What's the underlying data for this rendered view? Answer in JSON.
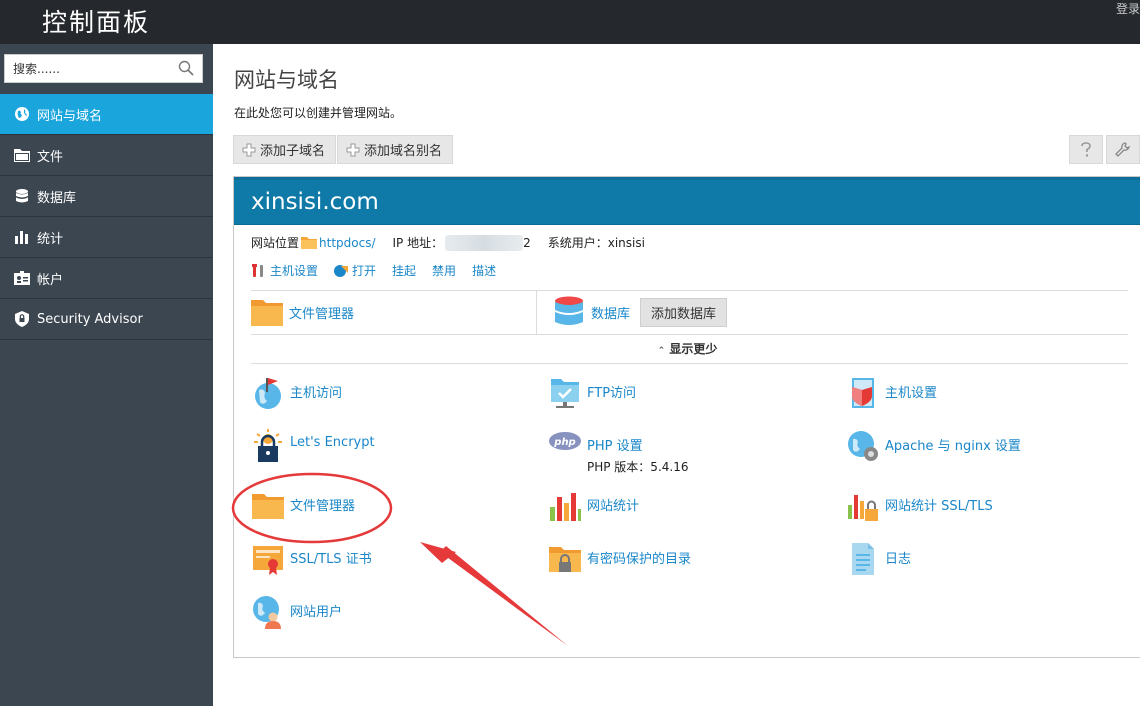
{
  "header": {
    "title": "控制面板",
    "login": "登录"
  },
  "sidebar": {
    "search_placeholder": "搜索......",
    "items": [
      {
        "label": "网站与域名",
        "icon": "globe-icon",
        "active": true
      },
      {
        "label": "文件",
        "icon": "folder-icon"
      },
      {
        "label": "数据库",
        "icon": "database-icon"
      },
      {
        "label": "统计",
        "icon": "bar-chart-icon"
      },
      {
        "label": "帐户",
        "icon": "id-card-icon"
      },
      {
        "label": "Security Advisor",
        "icon": "shield-icon"
      }
    ]
  },
  "main": {
    "title": "网站与域名",
    "description": "在此处您可以创建并管理网站。",
    "toolbar": {
      "add_subdomain": "添加子域名",
      "add_alias": "添加域名别名"
    },
    "domain": {
      "name": "xinsisi.com",
      "location_label": "网站位置",
      "location_link": "httpdocs/",
      "ip_label": "IP 地址：",
      "ip_tail": "2",
      "user_label": "系统用户：",
      "user_value": "xinsisi",
      "actions": [
        "主机设置",
        "打开",
        "挂起",
        "禁用",
        "描述"
      ],
      "quick": {
        "file_manager": "文件管理器",
        "database": "数据库",
        "add_database": "添加数据库"
      },
      "show_less": "显示更少",
      "tools": {
        "hosting_access": "主机访问",
        "ftp_access": "FTP访问",
        "hosting_settings": "主机设置",
        "lets_encrypt": "Let's Encrypt",
        "php_settings": "PHP 设置",
        "php_version": "PHP 版本：5.4.16",
        "apache_nginx": "Apache 与 nginx 设置",
        "file_manager": "文件管理器",
        "web_stats": "网站统计",
        "web_stats_ssl": "网站统计 SSL/TLS",
        "ssl_cert": "SSL/TLS 证书",
        "protected_dirs": "有密码保护的目录",
        "logs": "日志",
        "web_users": "网站用户"
      }
    }
  },
  "colors": {
    "accent": "#1aa5dd",
    "domain_header": "#0f7aa8",
    "link": "#1a87c9",
    "annotation": "#e5393a"
  }
}
